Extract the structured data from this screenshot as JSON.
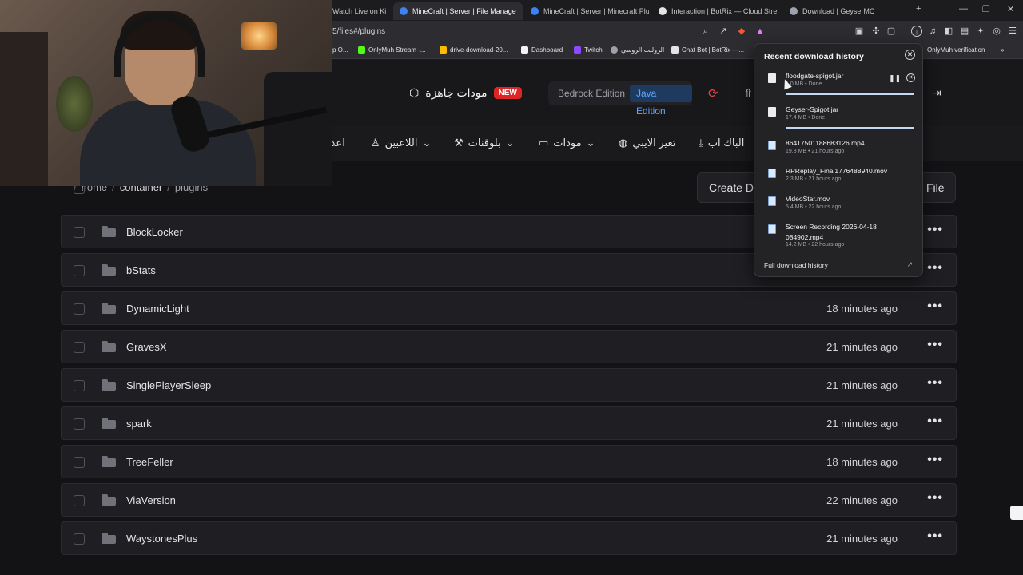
{
  "browser": {
    "tabs": [
      {
        "title": "Watch Live on Ki"
      },
      {
        "title": "MineCraft | Server | File Manage"
      },
      {
        "title": "MineCraft | Server | Minecraft Plugin"
      },
      {
        "title": "Interaction | BotRix — Cloud Stre"
      },
      {
        "title": "Download | GeyserMC"
      }
    ],
    "new_tab": "+",
    "url": "5/files#/plugins",
    "bookmarks": [
      {
        "label": "p O..."
      },
      {
        "label": "OnlyMuh Stream -..."
      },
      {
        "label": "drive-download-20..."
      },
      {
        "label": "Dashboard"
      },
      {
        "label": "Twitch"
      },
      {
        "label": "الرولبت الروسي"
      },
      {
        "label": "Chat Bot | BotRix —..."
      },
      {
        "label": "OnlyMuh verification"
      }
    ]
  },
  "header": {
    "ready_mods": "مودات جاهزة",
    "new_badge": "NEW",
    "editions": [
      "Bedrock Edition",
      "Java Edition"
    ],
    "active_edition": "Java Edition"
  },
  "menu": [
    {
      "label": "اعدا"
    },
    {
      "label": "اللاعبين"
    },
    {
      "label": "بلوقنات"
    },
    {
      "label": "مودات"
    },
    {
      "label": "تغير الايبي"
    },
    {
      "label": "الباك اب"
    }
  ],
  "breadcrumb": [
    "home",
    "container",
    "plugins"
  ],
  "actions": {
    "create": "Create D",
    "file": "File"
  },
  "files": [
    {
      "name": "BlockLocker",
      "time": ""
    },
    {
      "name": "bStats",
      "time": ""
    },
    {
      "name": "DynamicLight",
      "time": "18 minutes ago"
    },
    {
      "name": "GravesX",
      "time": "21 minutes ago"
    },
    {
      "name": "SinglePlayerSleep",
      "time": "21 minutes ago"
    },
    {
      "name": "spark",
      "time": "21 minutes ago"
    },
    {
      "name": "TreeFeller",
      "time": "18 minutes ago"
    },
    {
      "name": "ViaVersion",
      "time": "22 minutes ago"
    },
    {
      "name": "WaystonesPlus",
      "time": "21 minutes ago"
    }
  ],
  "downloads": {
    "title": "Recent download history",
    "items": [
      {
        "name": "floodgate-spigot.jar",
        "meta": "1.0 MB • Done"
      },
      {
        "name": "Geyser-Spigot.jar",
        "meta": "17.4 MB • Done"
      },
      {
        "name": "8641750118868312​6.mp4",
        "meta": "19.8 MB • 21 hours ago"
      },
      {
        "name": "RPReplay_Final1776488940.mov",
        "meta": "2.3 MB • 21 hours ago"
      },
      {
        "name": "VideoStar.mov",
        "meta": "5.4 MB • 22 hours ago"
      },
      {
        "name": "Screen Recording 2026-04-18",
        "name2": "084902.mp4",
        "meta": "14.2 MB • 22 hours ago"
      }
    ],
    "full_history": "Full download history"
  },
  "colors": {
    "accent": "#60a5fa",
    "danger": "#dc2626",
    "bg": "#131316",
    "row": "#1f1f23"
  }
}
